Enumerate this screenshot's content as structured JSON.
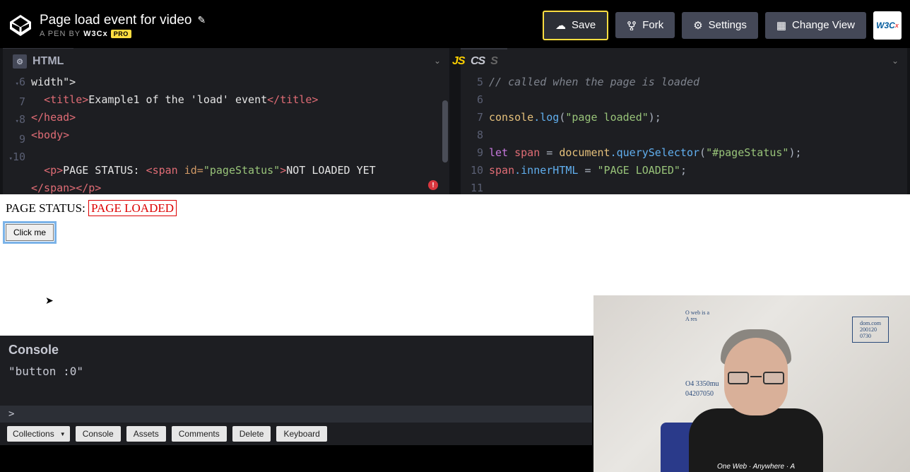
{
  "header": {
    "title": "Page load event for video",
    "subtitle_prefix": "A PEN BY",
    "author": "W3Cx",
    "pro_badge": "PRO",
    "save": "Save",
    "fork": "Fork",
    "settings": "Settings",
    "change_view": "Change View",
    "w3c": "W3C"
  },
  "editors": {
    "html_label": "HTML",
    "js_label": "JS",
    "css_label": "CSS"
  },
  "html_code": {
    "l5_tail": "width\">",
    "l6_open": "<title>",
    "l6_text": "Example1 of the 'load' event",
    "l6_close": "</title>",
    "l7": "</head>",
    "l8": "<body>",
    "l10_p_open": "<p>",
    "l10_text1": "PAGE STATUS: ",
    "l10_span_open": "<span ",
    "l10_attr": "id=",
    "l10_val": "\"pageStatus\"",
    "l10_close": ">",
    "l10_text2": "NOT LOADED YET",
    "l10_tail": "</span></p>",
    "gutter": [
      "",
      "6",
      "7",
      "8",
      "9",
      "10",
      ""
    ]
  },
  "js_code": {
    "l5_comment": "// called when the page is loaded",
    "l7_a": "console",
    "l7_b": ".log",
    "l7_c": "(",
    "l7_d": "\"page loaded\"",
    "l7_e": ");",
    "l9_a": "let ",
    "l9_b": "span",
    "l9_c": " = ",
    "l9_d": "document",
    "l9_e": ".querySelector",
    "l9_f": "(",
    "l9_g": "\"#pageStatus\"",
    "l9_h": ");",
    "l10_a": "span",
    "l10_b": ".innerHTML",
    "l10_c": " = ",
    "l10_d": "\"PAGE LOADED\"",
    "l10_e": ";",
    "gutter": [
      "5",
      "6",
      "7",
      "8",
      "9",
      "10",
      "11"
    ]
  },
  "result": {
    "prefix": "PAGE STATUS: ",
    "status": "PAGE LOADED",
    "button": "Click me"
  },
  "console": {
    "title": "Console",
    "output": "\"button :0\"",
    "prompt": ">"
  },
  "bottom": {
    "collections": "Collections",
    "console": "Console",
    "assets": "Assets",
    "comments": "Comments",
    "delete": "Delete",
    "keyboard": "Keyboard"
  },
  "webcam": {
    "shirt": "One Web · Anywhere · A",
    "wb1": "O4  3350mu",
    "wb2": "04207050"
  }
}
